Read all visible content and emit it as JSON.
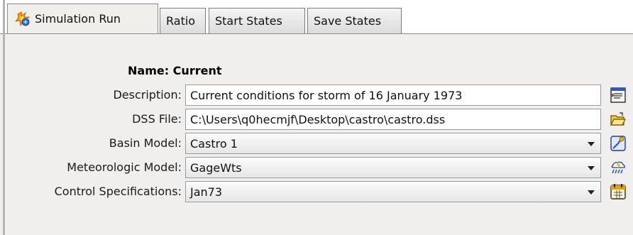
{
  "tabs": [
    {
      "label": "Simulation Run",
      "icon": "simulation-run-icon",
      "active": true
    },
    {
      "label": "Ratio",
      "active": false
    },
    {
      "label": "Start States",
      "active": false
    },
    {
      "label": "Save States",
      "active": false
    }
  ],
  "form": {
    "name_text": "Name: Current",
    "description": {
      "label": "Description:",
      "value": "Current conditions for storm of 16 January 1973",
      "button_icon": "edit-description-icon"
    },
    "dss_file": {
      "label": "DSS File:",
      "value": "C:\\Users\\q0hecmjf\\Desktop\\castro\\castro.dss",
      "button_icon": "open-folder-icon"
    },
    "basin_model": {
      "label": "Basin Model:",
      "value": "Castro 1",
      "button_icon": "basin-model-icon"
    },
    "meteorologic_model": {
      "label": "Meteorologic Model:",
      "value": "GageWts",
      "button_icon": "meteorologic-model-icon"
    },
    "control_specifications": {
      "label": "Control Specifications:",
      "value": "Jan73",
      "button_icon": "calendar-icon"
    }
  },
  "colors": {
    "panel_bg": "#f0efed",
    "icon_blue": "#2a58c9",
    "icon_orange": "#e8a000"
  }
}
